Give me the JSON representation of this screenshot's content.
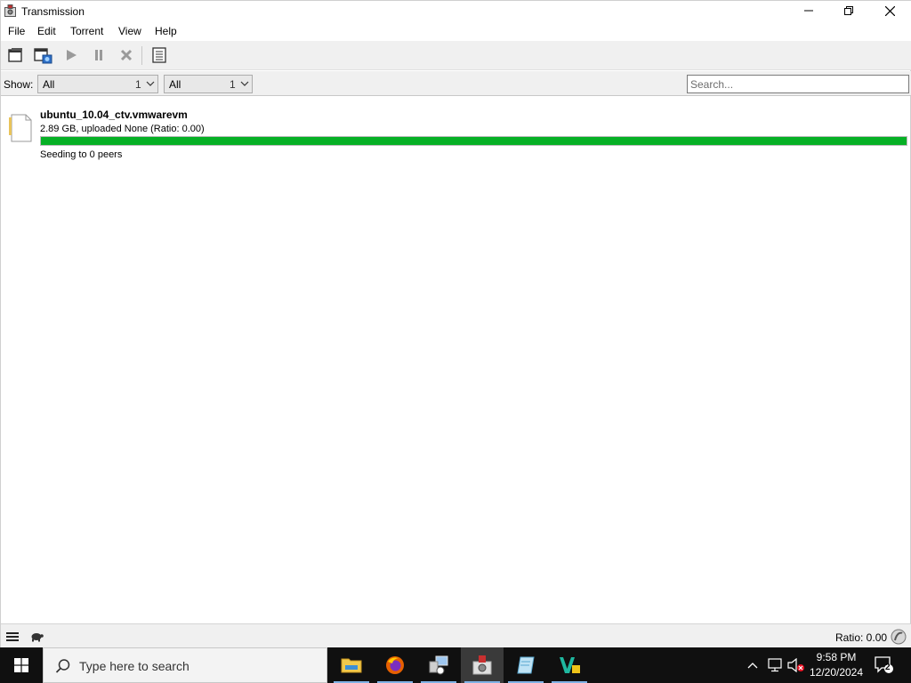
{
  "window": {
    "title": "Transmission"
  },
  "menu": [
    "File",
    "Edit",
    "Torrent",
    "View",
    "Help"
  ],
  "toolbar": {
    "icons": [
      "open-torrent-icon",
      "open-url-icon",
      "start-icon",
      "pause-icon",
      "remove-icon",
      "properties-icon"
    ]
  },
  "filter": {
    "show_label": "Show:",
    "activity": {
      "value": "All",
      "count": "1"
    },
    "tracker": {
      "value": "All",
      "count": "1"
    },
    "search_placeholder": "Search..."
  },
  "torrents": [
    {
      "name": "ubuntu_10.04_ctv.vmwarevm",
      "progress_text": "2.89 GB, uploaded None (Ratio: 0.00)",
      "percent_done": 1.0,
      "status": "Seeding to 0 peers"
    }
  ],
  "statusbar": {
    "ratio": "Ratio: 0.00"
  },
  "taskbar": {
    "search_text": "Type here to search",
    "time": "9:58 PM",
    "date": "12/20/2024",
    "notification_count": "2"
  },
  "colors": {
    "progress_seeding": "#06b025",
    "taskbar_bg": "#101010"
  }
}
